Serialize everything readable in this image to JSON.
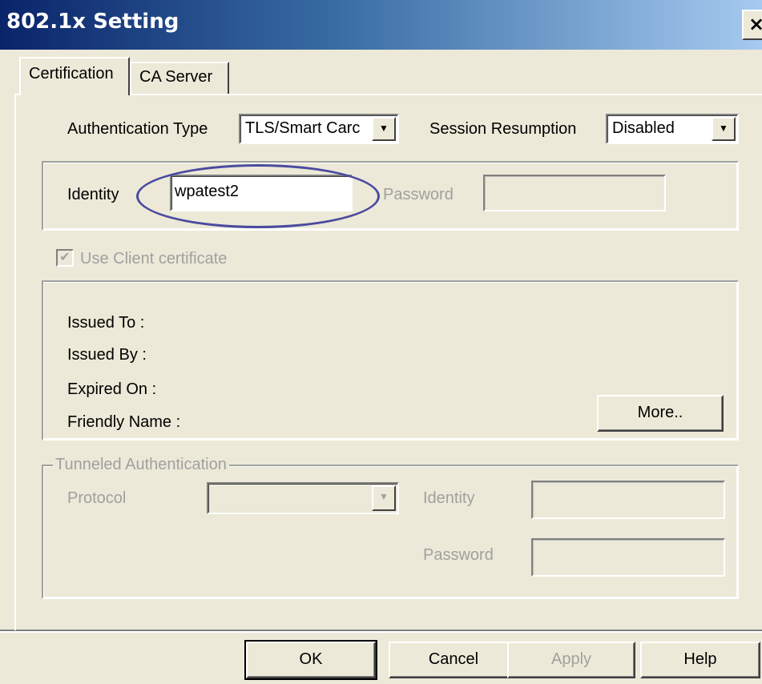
{
  "window": {
    "title": "802.1x Setting",
    "close_glyph": "×"
  },
  "tabs": [
    {
      "label": "Certification"
    },
    {
      "label": "CA Server"
    }
  ],
  "auth": {
    "type_label": "Authentication Type",
    "type_value": "TLS/Smart Carc",
    "session_label": "Session Resumption",
    "session_value": "Disabled"
  },
  "identity": {
    "label": "Identity",
    "value": "wpatest2",
    "password_label": "Password",
    "password_value": ""
  },
  "certificate": {
    "use_client_label": "Use Client certificate",
    "use_client_checked": true,
    "issued_to": "Issued To :",
    "issued_by": "Issued By :",
    "expired_on": "Expired On :",
    "friendly_name": "Friendly Name :",
    "more_label": "More.."
  },
  "tunneled": {
    "legend": "Tunneled Authentication",
    "protocol_label": "Protocol",
    "protocol_value": "",
    "identity_label": "Identity",
    "identity_value": "",
    "password_label": "Password",
    "password_value": ""
  },
  "buttons": {
    "ok": "OK",
    "cancel": "Cancel",
    "apply": "Apply",
    "help": "Help"
  },
  "icons": {
    "dropdown": "chevron-down-icon",
    "check": "checkmark-icon",
    "close": "close-icon"
  },
  "colors": {
    "titlebar_start": "#0a246a",
    "titlebar_end": "#a6caf0",
    "face": "#ece9d8",
    "highlight_ellipse": "#4a4aa0"
  }
}
